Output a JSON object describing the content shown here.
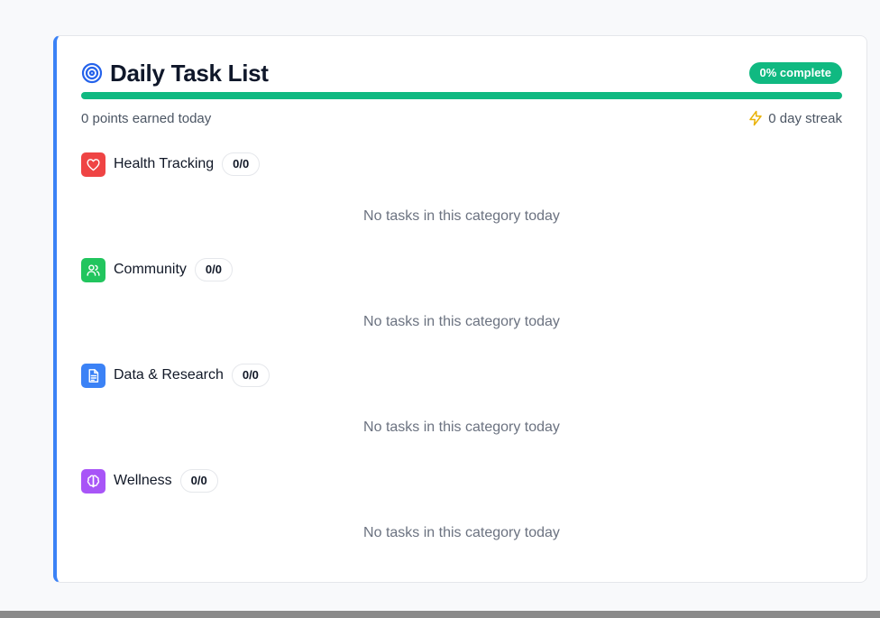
{
  "header": {
    "title": "Daily Task List",
    "title_icon": "target-icon",
    "completion_badge": "0% complete",
    "completion_fraction": 0.0
  },
  "stats": {
    "points": "0 points earned today",
    "streak": "0 day streak",
    "streak_icon": "lightning-icon"
  },
  "categories": [
    {
      "name": "Health Tracking",
      "count": "0/0",
      "icon": "heart-icon",
      "color": "#ef4444",
      "empty_text": "No tasks in this category today"
    },
    {
      "name": "Community",
      "count": "0/0",
      "icon": "users-icon",
      "color": "#22c55e",
      "empty_text": "No tasks in this category today"
    },
    {
      "name": "Data & Research",
      "count": "0/0",
      "icon": "document-icon",
      "color": "#3b82f6",
      "empty_text": "No tasks in this category today"
    },
    {
      "name": "Wellness",
      "count": "0/0",
      "icon": "brain-icon",
      "color": "#a855f7",
      "empty_text": "No tasks in this category today"
    }
  ],
  "colors": {
    "accent": "#3b82f6",
    "progress": "#10b981",
    "streak_icon": "#eab308"
  }
}
